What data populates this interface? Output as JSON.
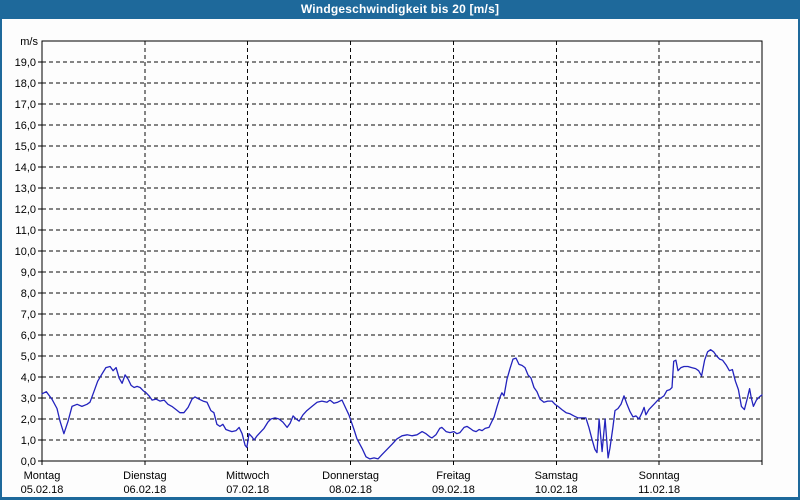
{
  "title": "Windgeschwindigkeit bis 20 [m/s]",
  "colors": {
    "titlebar": "#1e699b",
    "window_border": "#1e699b",
    "curve": "#2323bd",
    "grid": "#0a0a0a",
    "background": "#fdfdfd",
    "label": "#000000"
  },
  "y_axis": {
    "unit": "m/s",
    "tick_labels": [
      "19,0",
      "18,0",
      "17,0",
      "16,0",
      "15,0",
      "14,0",
      "13,0",
      "12,0",
      "11,0",
      "10,0",
      "9,0",
      "8,0",
      "7,0",
      "6,0",
      "5,0",
      "4,0",
      "3,0",
      "2,0",
      "1,0",
      "0,0"
    ]
  },
  "x_axis": {
    "days": [
      {
        "name": "Montag",
        "date": "05.02.18"
      },
      {
        "name": "Dienstag",
        "date": "06.02.18"
      },
      {
        "name": "Mittwoch",
        "date": "07.02.18"
      },
      {
        "name": "Donnerstag",
        "date": "08.02.18"
      },
      {
        "name": "Freitag",
        "date": "09.02.18"
      },
      {
        "name": "Samstag",
        "date": "10.02.18"
      },
      {
        "name": "Sonntag",
        "date": "11.02.18"
      }
    ]
  },
  "chart_data": {
    "type": "line",
    "title": "Windgeschwindigkeit bis 20 [m/s]",
    "ylabel": "m/s",
    "ylim": [
      0,
      20
    ],
    "y_step": 1,
    "x_unit": "hours from Montag 05.02.18 00:00",
    "xlim": [
      0,
      168
    ],
    "grid": true,
    "legend": "none",
    "series": [
      {
        "name": "Windgeschwindigkeit",
        "color": "#2323bd",
        "points": [
          [
            0,
            3.2
          ],
          [
            1,
            3.3
          ],
          [
            2.3,
            2.95
          ],
          [
            3.5,
            2.5
          ],
          [
            4.2,
            1.9
          ],
          [
            5.1,
            1.3
          ],
          [
            6.1,
            1.9
          ],
          [
            7,
            2.6
          ],
          [
            8.2,
            2.7
          ],
          [
            9.3,
            2.6
          ],
          [
            10.5,
            2.7
          ],
          [
            11.2,
            2.8
          ],
          [
            12.1,
            3.3
          ],
          [
            13,
            3.8
          ],
          [
            14,
            4.15
          ],
          [
            14.9,
            4.45
          ],
          [
            15.9,
            4.5
          ],
          [
            16.6,
            4.3
          ],
          [
            17.3,
            4.45
          ],
          [
            18,
            3.95
          ],
          [
            18.7,
            3.7
          ],
          [
            19.4,
            4.1
          ],
          [
            20.1,
            3.9
          ],
          [
            20.8,
            3.6
          ],
          [
            21.5,
            3.5
          ],
          [
            22.2,
            3.55
          ],
          [
            22.9,
            3.5
          ],
          [
            23.6,
            3.35
          ],
          [
            24.3,
            3.25
          ],
          [
            25,
            3.1
          ],
          [
            25.7,
            2.9
          ],
          [
            26.6,
            2.95
          ],
          [
            27.5,
            2.85
          ],
          [
            28.5,
            2.9
          ],
          [
            29.4,
            2.7
          ],
          [
            30.3,
            2.6
          ],
          [
            31.3,
            2.45
          ],
          [
            32.2,
            2.3
          ],
          [
            33.1,
            2.3
          ],
          [
            34.1,
            2.55
          ],
          [
            35,
            2.95
          ],
          [
            35.7,
            3.05
          ],
          [
            36.6,
            2.95
          ],
          [
            37.6,
            2.85
          ],
          [
            38.5,
            2.8
          ],
          [
            39.4,
            2.4
          ],
          [
            40.1,
            2.3
          ],
          [
            40.8,
            1.75
          ],
          [
            41.5,
            1.65
          ],
          [
            42.2,
            1.75
          ],
          [
            42.9,
            1.5
          ],
          [
            43.6,
            1.45
          ],
          [
            44.3,
            1.4
          ],
          [
            45.3,
            1.45
          ],
          [
            46,
            1.6
          ],
          [
            46.7,
            1.3
          ],
          [
            47.4,
            0.75
          ],
          [
            47.8,
            0.65
          ],
          [
            48.3,
            1.3
          ],
          [
            49,
            1.15
          ],
          [
            49.5,
            1.0
          ],
          [
            50.2,
            1.2
          ],
          [
            50.9,
            1.35
          ],
          [
            51.8,
            1.55
          ],
          [
            52.7,
            1.85
          ],
          [
            53.4,
            2.0
          ],
          [
            54.4,
            2.05
          ],
          [
            55.3,
            2.0
          ],
          [
            56.2,
            1.85
          ],
          [
            57.2,
            1.6
          ],
          [
            57.9,
            1.8
          ],
          [
            58.6,
            2.15
          ],
          [
            59.3,
            2.0
          ],
          [
            60,
            1.9
          ],
          [
            60.9,
            2.2
          ],
          [
            61.8,
            2.4
          ],
          [
            63,
            2.6
          ],
          [
            64.2,
            2.8
          ],
          [
            65.3,
            2.85
          ],
          [
            66.5,
            2.8
          ],
          [
            67.2,
            2.9
          ],
          [
            68.1,
            2.75
          ],
          [
            69,
            2.8
          ],
          [
            70,
            2.9
          ],
          [
            70.9,
            2.5
          ],
          [
            71.6,
            2.2
          ],
          [
            72.8,
            1.5
          ],
          [
            73.5,
            1.05
          ],
          [
            74.7,
            0.6
          ],
          [
            75.6,
            0.2
          ],
          [
            76.5,
            0.1
          ],
          [
            77.5,
            0.15
          ],
          [
            78.4,
            0.1
          ],
          [
            79.3,
            0.3
          ],
          [
            80.5,
            0.55
          ],
          [
            81.7,
            0.8
          ],
          [
            82.8,
            1.05
          ],
          [
            84,
            1.2
          ],
          [
            85.2,
            1.25
          ],
          [
            86.3,
            1.2
          ],
          [
            87.5,
            1.25
          ],
          [
            88.7,
            1.4
          ],
          [
            89.6,
            1.3
          ],
          [
            90.5,
            1.15
          ],
          [
            91,
            1.1
          ],
          [
            91.9,
            1.25
          ],
          [
            92.8,
            1.55
          ],
          [
            93.3,
            1.6
          ],
          [
            94.3,
            1.4
          ],
          [
            95.2,
            1.35
          ],
          [
            96.1,
            1.4
          ],
          [
            96.8,
            1.3
          ],
          [
            97.5,
            1.35
          ],
          [
            98.5,
            1.6
          ],
          [
            99.2,
            1.65
          ],
          [
            99.9,
            1.55
          ],
          [
            100.6,
            1.45
          ],
          [
            101.3,
            1.4
          ],
          [
            102,
            1.5
          ],
          [
            102.7,
            1.45
          ],
          [
            103.4,
            1.55
          ],
          [
            104.3,
            1.6
          ],
          [
            105,
            1.9
          ],
          [
            105.5,
            2.1
          ],
          [
            106.2,
            2.6
          ],
          [
            106.9,
            3.05
          ],
          [
            107.3,
            3.25
          ],
          [
            107.8,
            3.1
          ],
          [
            108.5,
            3.9
          ],
          [
            109.2,
            4.4
          ],
          [
            109.9,
            4.85
          ],
          [
            110.6,
            4.9
          ],
          [
            111.3,
            4.6
          ],
          [
            112,
            4.55
          ],
          [
            112.7,
            4.45
          ],
          [
            113.4,
            4.1
          ],
          [
            114.1,
            3.95
          ],
          [
            114.8,
            3.5
          ],
          [
            115.5,
            3.3
          ],
          [
            116.2,
            2.95
          ],
          [
            117.1,
            2.8
          ],
          [
            118,
            2.85
          ],
          [
            119,
            2.85
          ],
          [
            119.7,
            2.7
          ],
          [
            120.4,
            2.6
          ],
          [
            121.3,
            2.45
          ],
          [
            122.3,
            2.3
          ],
          [
            123.2,
            2.25
          ],
          [
            124.1,
            2.15
          ],
          [
            125.1,
            2.05
          ],
          [
            126,
            2.05
          ],
          [
            126.9,
            2.05
          ],
          [
            127.6,
            1.6
          ],
          [
            128.3,
            1.05
          ],
          [
            129,
            0.55
          ],
          [
            129.5,
            0.4
          ],
          [
            130,
            2.0
          ],
          [
            130.7,
            0.45
          ],
          [
            131.4,
            2.0
          ],
          [
            132.1,
            0.15
          ],
          [
            132.5,
            0.6
          ],
          [
            133.2,
            1.6
          ],
          [
            133.7,
            2.4
          ],
          [
            134.4,
            2.5
          ],
          [
            135.1,
            2.7
          ],
          [
            135.8,
            3.1
          ],
          [
            136.5,
            2.7
          ],
          [
            137.2,
            2.35
          ],
          [
            137.9,
            2.1
          ],
          [
            138.6,
            2.15
          ],
          [
            139.3,
            2.0
          ],
          [
            140,
            2.3
          ],
          [
            140.5,
            2.55
          ],
          [
            140.9,
            2.2
          ],
          [
            141.6,
            2.45
          ],
          [
            142.3,
            2.6
          ],
          [
            143,
            2.75
          ],
          [
            143.7,
            2.9
          ],
          [
            144.4,
            3.0
          ],
          [
            145.1,
            3.1
          ],
          [
            145.8,
            3.35
          ],
          [
            146.5,
            3.4
          ],
          [
            147,
            3.5
          ],
          [
            147.4,
            4.75
          ],
          [
            147.9,
            4.8
          ],
          [
            148.4,
            4.3
          ],
          [
            149.1,
            4.45
          ],
          [
            149.8,
            4.5
          ],
          [
            150.7,
            4.5
          ],
          [
            151.6,
            4.45
          ],
          [
            152.5,
            4.4
          ],
          [
            153.2,
            4.3
          ],
          [
            153.9,
            4.05
          ],
          [
            154.6,
            4.8
          ],
          [
            155.3,
            5.2
          ],
          [
            156,
            5.3
          ],
          [
            156.7,
            5.2
          ],
          [
            157.4,
            5.0
          ],
          [
            158.1,
            4.85
          ],
          [
            158.8,
            4.8
          ],
          [
            159.7,
            4.55
          ],
          [
            160.4,
            4.3
          ],
          [
            161.1,
            4.35
          ],
          [
            161.8,
            3.8
          ],
          [
            162.5,
            3.4
          ],
          [
            163.2,
            2.6
          ],
          [
            163.9,
            2.45
          ],
          [
            164.6,
            3.0
          ],
          [
            165.1,
            3.45
          ],
          [
            165.5,
            3.0
          ],
          [
            166,
            2.6
          ],
          [
            166.7,
            2.9
          ],
          [
            167.4,
            3.05
          ],
          [
            168,
            3.15
          ]
        ]
      }
    ]
  }
}
